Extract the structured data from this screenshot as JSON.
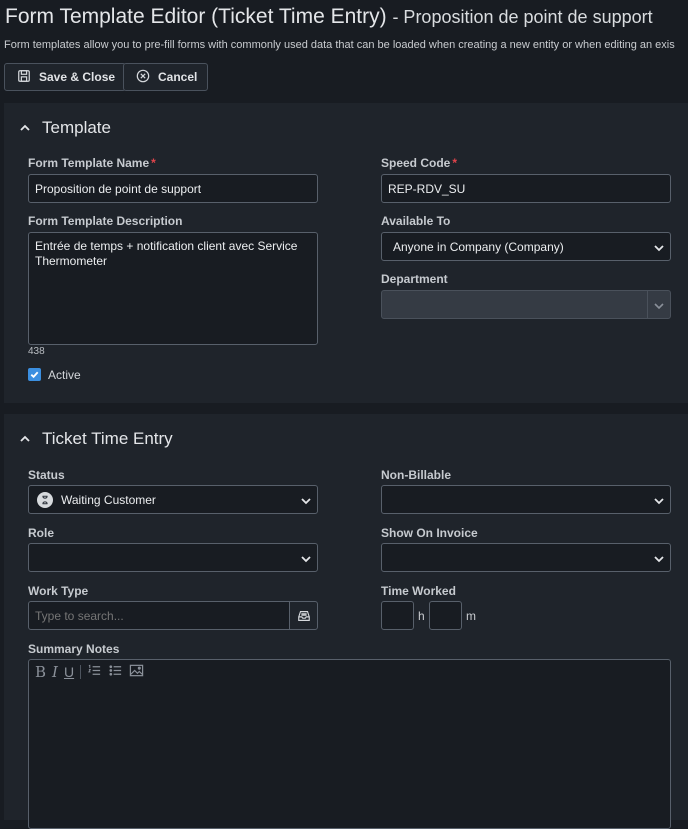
{
  "header": {
    "title": "Form Template Editor (Ticket Time Entry)",
    "subtitle": "- Proposition de point de support",
    "description": "Form templates allow you to pre-fill forms with commonly used data that can be loaded when creating a new entity or when editing an exis"
  },
  "toolbar": {
    "save_label": "Save & Close",
    "cancel_label": "Cancel"
  },
  "template_section": {
    "title": "Template",
    "name_label": "Form Template Name",
    "name_value": "Proposition de point de support",
    "speed_code_label": "Speed Code",
    "speed_code_value": "REP-RDV_SU",
    "description_label": "Form Template Description",
    "description_value": "Entrée de temps + notification client avec Service Thermometer",
    "char_count": "438",
    "available_to_label": "Available To",
    "available_to_value": "Anyone in Company (Company)",
    "department_label": "Department",
    "department_value": "",
    "active_label": "Active",
    "active_checked": true
  },
  "ticket_section": {
    "title": "Ticket Time Entry",
    "status_label": "Status",
    "status_value": "Waiting Customer",
    "non_billable_label": "Non-Billable",
    "non_billable_value": "",
    "role_label": "Role",
    "role_value": "",
    "show_on_invoice_label": "Show On Invoice",
    "show_on_invoice_value": "",
    "work_type_label": "Work Type",
    "work_type_placeholder": "Type to search...",
    "time_worked_label": "Time Worked",
    "hours_unit": "h",
    "minutes_unit": "m",
    "summary_notes_label": "Summary Notes"
  },
  "icons": {
    "save": "floppy-disk-icon",
    "cancel": "circle-x-icon",
    "collapse": "chevron-up-icon",
    "dropdown": "chevron-down-icon",
    "status": "hourglass-icon",
    "lookup": "tray-icon"
  },
  "colors": {
    "background": "#181c22",
    "panel": "#1f242b",
    "required": "#e0444b",
    "checkbox": "#3b8fe0"
  }
}
